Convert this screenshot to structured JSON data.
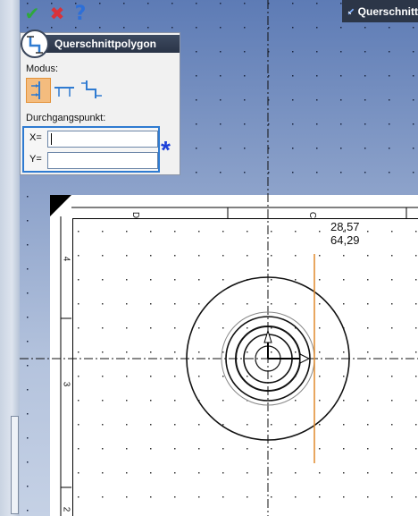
{
  "toolbar": {
    "accept_icon": "check-icon",
    "cancel_icon": "x-icon",
    "help_icon": "question-icon"
  },
  "window": {
    "title": "Querschnitt"
  },
  "panel": {
    "title": "Querschnittpolygon",
    "mode_label": "Modus:",
    "point_label": "Durchgangspunkt:",
    "x_label": "X=",
    "y_label": "Y=",
    "x_value": "",
    "y_value": "",
    "required_marker": "*"
  },
  "drawing": {
    "coord_x": "28,57",
    "coord_y": "64,29",
    "zone_top": [
      "D",
      "C"
    ],
    "zone_left": [
      "4",
      "3",
      "2"
    ]
  },
  "colors": {
    "accent": "#2f7bd1",
    "active_mode": "#f4bc7e",
    "section_line": "#e08a2c",
    "asterisk": "#1c3fd9"
  }
}
